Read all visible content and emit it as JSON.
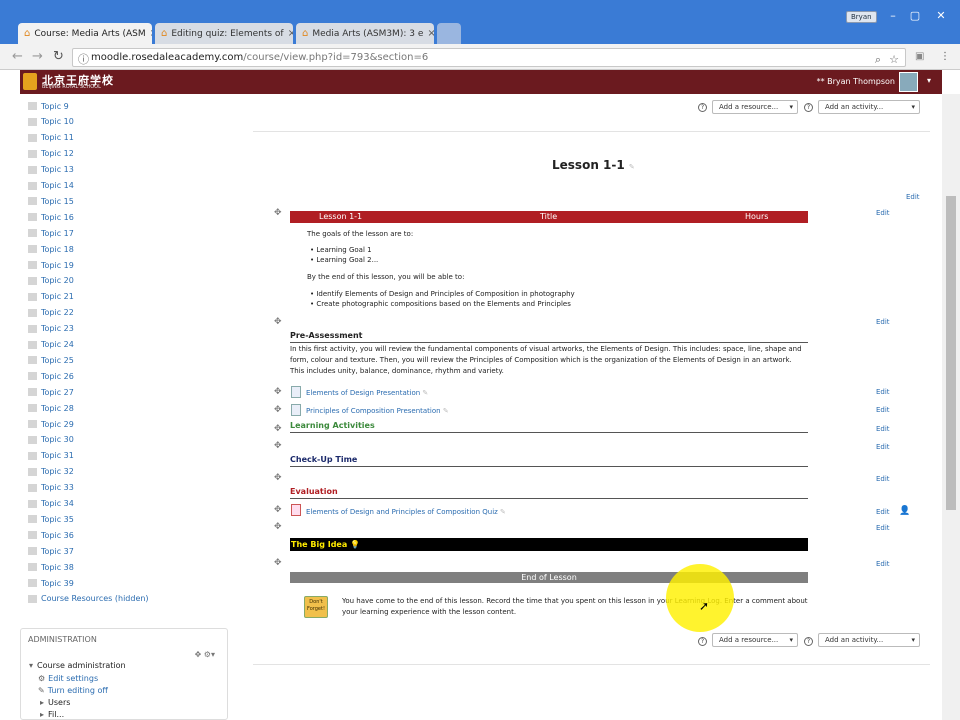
{
  "browser": {
    "tabs": [
      {
        "label": "Course: Media Arts (ASM",
        "active": true
      },
      {
        "label": "Editing quiz: Elements of",
        "active": false
      },
      {
        "label": "Media Arts (ASM3M): 3 e",
        "active": false
      }
    ],
    "address": "moodle.rosedaleacademy.com",
    "address_path": "/course/view.php?id=793&section=6",
    "window_user": "Bryan"
  },
  "site": {
    "logo_cn": "北京王府学校",
    "logo_en": "BEIJING ROYAL SCHOOL",
    "user_name": "Bryan Thompson",
    "brand_color": "#6b1a1f"
  },
  "sidebar": {
    "topics": [
      "Topic 9",
      "Topic 10",
      "Topic 11",
      "Topic 12",
      "Topic 13",
      "Topic 14",
      "Topic 15",
      "Topic 16",
      "Topic 17",
      "Topic 18",
      "Topic 19",
      "Topic 20",
      "Topic 21",
      "Topic 22",
      "Topic 23",
      "Topic 24",
      "Topic 25",
      "Topic 26",
      "Topic 27",
      "Topic 28",
      "Topic 29",
      "Topic 30",
      "Topic 31",
      "Topic 32",
      "Topic 33",
      "Topic 34",
      "Topic 35",
      "Topic 36",
      "Topic 37",
      "Topic 38",
      "Topic 39",
      "Course Resources (hidden)"
    ],
    "admin": {
      "title": "ADMINISTRATION",
      "course_admin": "Course administration",
      "edit_settings": "Edit settings",
      "turn_editing_off": "Turn editing off",
      "users": "Users",
      "next": "Fil..."
    }
  },
  "main": {
    "add_resource": "Add a resource...",
    "add_activity": "Add an activity...",
    "section_title": "Lesson 1-1",
    "edit_label": "Edit",
    "table_header": {
      "c1": "Lesson 1-1",
      "c2": "Title",
      "c3": "Hours"
    },
    "goals_intro": "The goals of the lesson are to:",
    "goals": [
      "Learning Goal 1",
      "Learning Goal 2..."
    ],
    "able_intro": "By the end of this lesson, you will be able to:",
    "abilities": [
      "Identify Elements of Design and Principles of Composition in photography",
      "Create photographic compositions based on the Elements and Principles"
    ],
    "pre_title": "Pre-Assessment",
    "pre_text": "In this first activity, you will review the fundamental components of visual artworks, the Elements of Design. This includes: space, line, shape and form, colour and texture. Then, you will review the Principles of Composition which is the organization of the Elements of Design in an artwork. This includes unity, balance, dominance, rhythm and variety.",
    "res1": "Elements of Design Presentation",
    "res2": "Principles of Composition Presentation",
    "learning_title": "Learning Activities",
    "checkup_title": "Check-Up Time",
    "eval_title": "Evaluation",
    "quiz": "Elements of Design and Principles of Composition Quiz",
    "bigidea": "The Big Idea",
    "end_title": "End of Lesson",
    "end_text_1": "You have come to the end of this lesson. Record the time that you spent on this lesson in your Learning Log. Enter a comment about",
    "end_text_2": "your learning experience with the lesson content.",
    "dontforget": "Don't Forget!"
  }
}
